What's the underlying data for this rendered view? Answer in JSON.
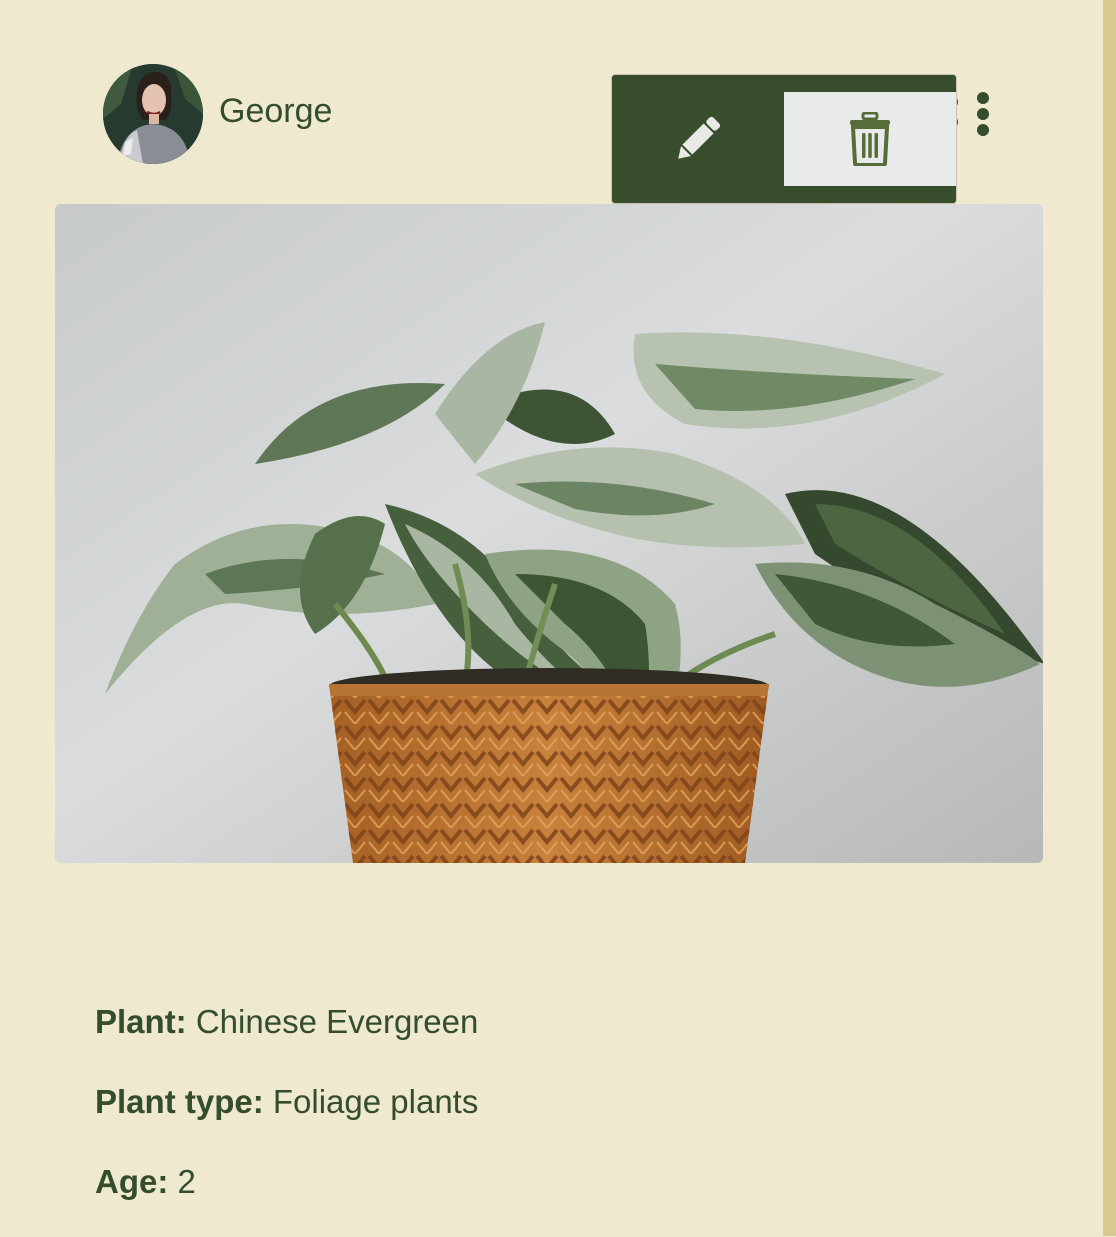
{
  "post": {
    "author_name": "George",
    "menu": {
      "edit_icon": "pencil-icon",
      "delete_icon": "trash-icon",
      "more_icon": "kebab-vertical-icon"
    },
    "details": {
      "plant_label": "Plant:",
      "plant_value": "Chinese Evergreen",
      "type_label": "Plant type:",
      "type_value": "Foliage plants",
      "age_label": "Age:",
      "age_value": "2"
    }
  },
  "colors": {
    "background": "#efe9d0",
    "primary_green": "#374d2c",
    "text_green": "#344d2c",
    "delete_bg": "#e9eaea",
    "rail": "#d9c991"
  }
}
